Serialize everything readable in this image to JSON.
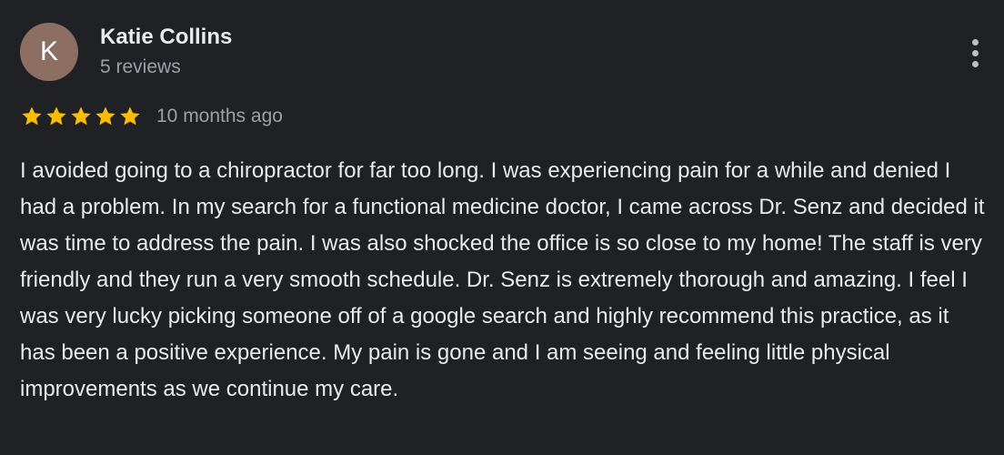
{
  "review": {
    "avatar_initial": "K",
    "avatar_color": "#8d6e63",
    "reviewer_name": "Katie Collins",
    "reviewer_meta": "5 reviews",
    "rating": 5,
    "rating_max": 5,
    "star_color": "#fbbc04",
    "date": "10 months ago",
    "more_icon": "more-vert-icon",
    "text": "I avoided going to a chiropractor for far too long. I was experiencing pain for a while and denied I had a problem. In my search for a functional medicine doctor, I came across Dr. Senz and decided it was time to address the pain. I was also shocked the office is so close to my home! The staff is very friendly and they run a very smooth schedule. Dr. Senz is extremely thorough and amazing. I feel I was very lucky picking someone off of a google search and highly recommend this practice, as it has been a positive experience. My pain is gone and I am seeing and feeling little physical improvements as we continue my care."
  }
}
